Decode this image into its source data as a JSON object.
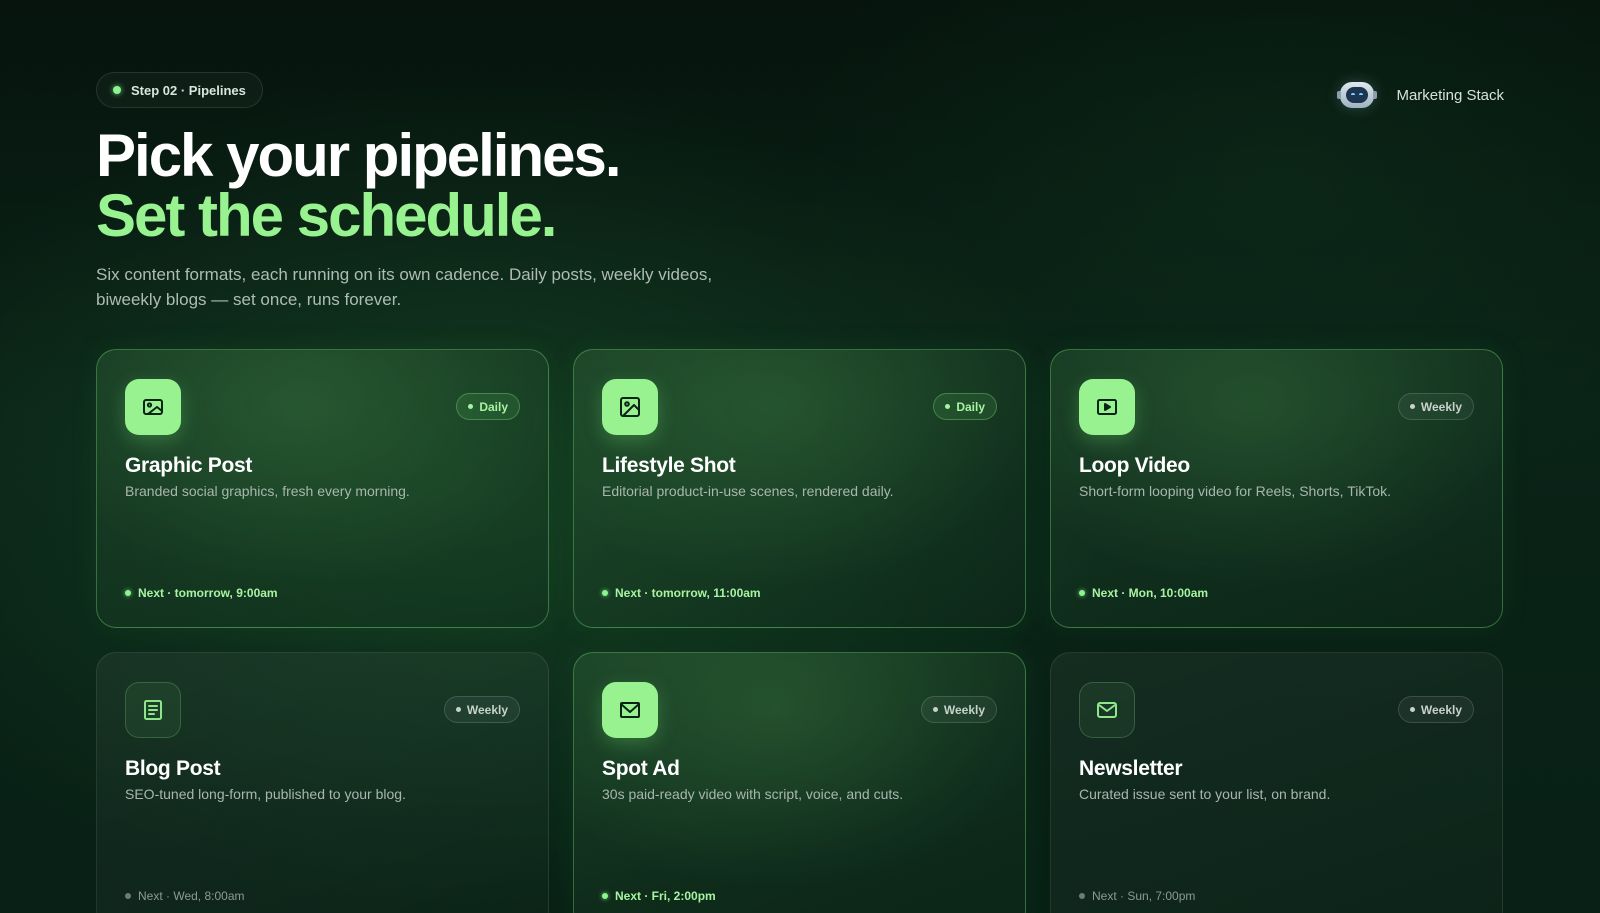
{
  "header": {
    "step_label": "Step 02 · Pipelines",
    "brand_name": "Marketing Stack",
    "brand_icon": "robot-icon",
    "title_line1": "Pick your pipelines.",
    "title_line2": "Set the schedule.",
    "subtitle": "Six content formats, each running on its own cadence. Daily posts, weekly videos, biweekly blogs — set once, runs forever."
  },
  "colors": {
    "accent": "#97f28f",
    "background": "#0a2317"
  },
  "pipelines": [
    {
      "title": "Graphic Post",
      "description": "Branded social graphics, fresh every morning.",
      "frequency": "Daily",
      "next": "Next · tomorrow, 9:00am",
      "icon": "image-icon",
      "selected": true
    },
    {
      "title": "Lifestyle Shot",
      "description": "Editorial product-in-use scenes, rendered daily.",
      "frequency": "Daily",
      "next": "Next · tomorrow, 11:00am",
      "icon": "photo-icon",
      "selected": true
    },
    {
      "title": "Loop Video",
      "description": "Short-form looping video for Reels, Shorts, TikTok.",
      "frequency": "Weekly",
      "next": "Next · Mon, 10:00am",
      "icon": "video-play-icon",
      "selected": true
    },
    {
      "title": "Blog Post",
      "description": "SEO-tuned long-form, published to your blog.",
      "frequency": "Weekly",
      "next": "Next · Wed, 8:00am",
      "icon": "document-icon",
      "selected": false
    },
    {
      "title": "Spot Ad",
      "description": "30s paid-ready video with script, voice, and cuts.",
      "frequency": "Weekly",
      "next": "Next · Fri, 2:00pm",
      "icon": "envelope-icon",
      "selected": true
    },
    {
      "title": "Newsletter",
      "description": "Curated issue sent to your list, on brand.",
      "frequency": "Weekly",
      "next": "Next · Sun, 7:00pm",
      "icon": "mail-icon",
      "selected": false
    }
  ]
}
